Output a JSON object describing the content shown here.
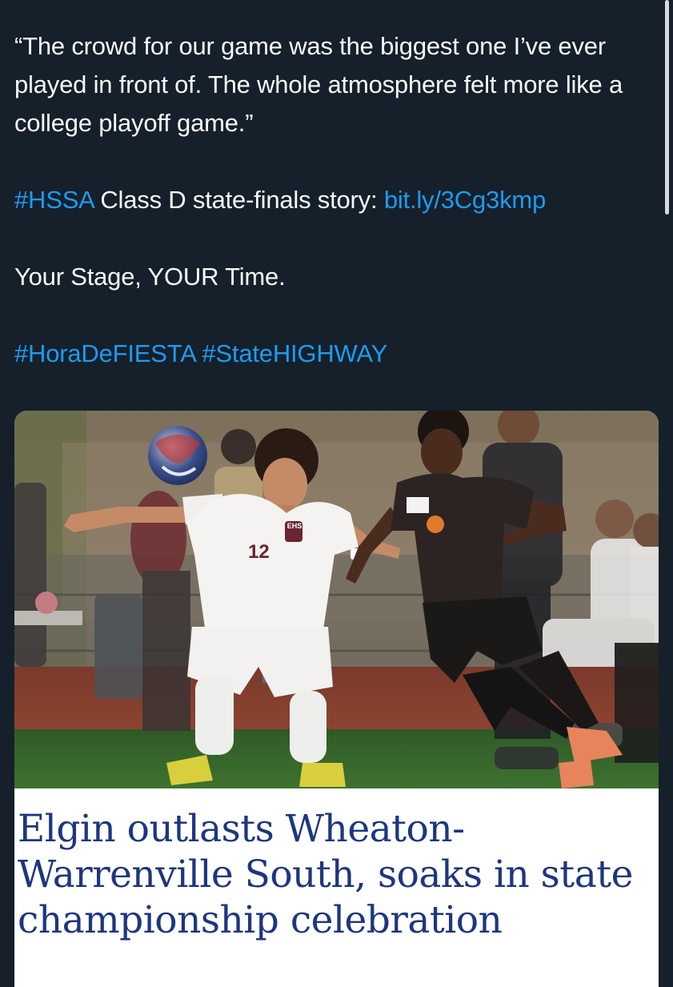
{
  "tweet": {
    "quote": "“The crowd for our game was the biggest one I’ve ever played in front of. The whole atmosphere felt more like a college playoff game.”",
    "hashtag_hssa": "#HSSA",
    "story_text": " Class D state-finals story: ",
    "story_link": "bit.ly/3Cg3kmp",
    "tagline": "Your Stage, YOUR Time.",
    "hashtag_fiesta": "#HoraDeFIESTA",
    "hashtag_space": " ",
    "hashtag_highway": "#StateHIGHWAY"
  },
  "card": {
    "jersey_number": "12",
    "crest_text": "EHS",
    "headline": "Elgin outlasts Wheaton-Warrenville South, soaks in state championship celebration"
  },
  "colors": {
    "background": "#15202b",
    "text": "#f7f9f9",
    "link": "#1d9bf0",
    "headline": "#1d3680"
  }
}
